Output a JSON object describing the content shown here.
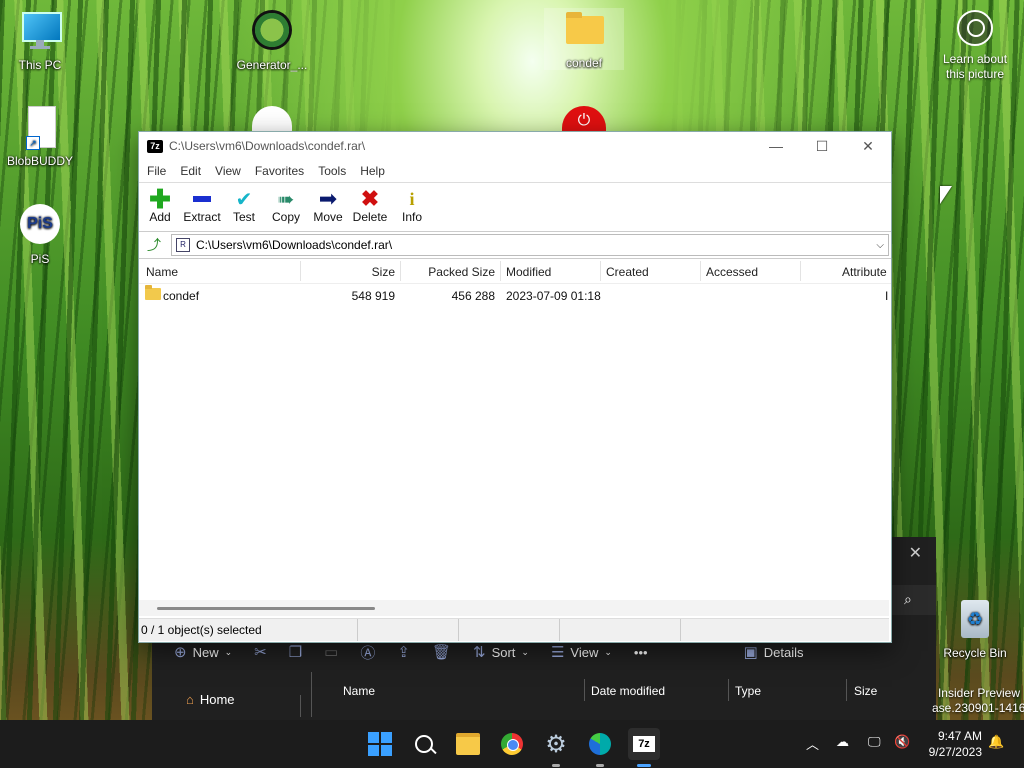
{
  "desktop": {
    "icons": [
      {
        "label": "This PC"
      },
      {
        "label": "Generator_..."
      },
      {
        "label": "condef"
      },
      {
        "label": "BlobBUDDY"
      },
      {
        "label": "PiS"
      },
      {
        "label": "Recycle Bin"
      }
    ],
    "learn_label_1": "Learn about",
    "learn_label_2": "this picture",
    "insider_1": "Insider Preview",
    "insider_2": "ase.230901-1416"
  },
  "explorer_bg": {
    "toolbar": {
      "new": "New",
      "sort": "Sort",
      "view": "View",
      "details": "Details",
      "more": "•••"
    },
    "nav_home": "Home",
    "columns": [
      "Name",
      "Date modified",
      "Type",
      "Size"
    ]
  },
  "zip": {
    "title": "C:\\Users\\vm6\\Downloads\\condef.rar\\",
    "app_icon": "7z",
    "menu": [
      "File",
      "Edit",
      "View",
      "Favorites",
      "Tools",
      "Help"
    ],
    "tools": [
      {
        "label": "Add",
        "icon": "plus-icon",
        "color": "#1fa81f"
      },
      {
        "label": "Extract",
        "icon": "minus-icon",
        "color": "#1a2fd0"
      },
      {
        "label": "Test",
        "icon": "check-icon",
        "color": "#16b5c9"
      },
      {
        "label": "Copy",
        "icon": "double-arrow-icon",
        "color": "#2a8a6a"
      },
      {
        "label": "Move",
        "icon": "arrow-right-icon",
        "color": "#0a1a6e"
      },
      {
        "label": "Delete",
        "icon": "x-icon",
        "color": "#d01010"
      },
      {
        "label": "Info",
        "icon": "info-icon",
        "color": "#d8c010"
      }
    ],
    "address": "C:\\Users\\vm6\\Downloads\\condef.rar\\",
    "columns": [
      "Name",
      "Size",
      "Packed Size",
      "Modified",
      "Created",
      "Accessed",
      "Attribute"
    ],
    "rows": [
      {
        "name": "condef",
        "size": "548 919",
        "packed": "456 288",
        "modified": "2023-07-09 01:18",
        "created": "",
        "accessed": "",
        "attr": "I"
      }
    ],
    "status": "0 / 1 object(s) selected"
  },
  "taskbar": {
    "time": "9:47 AM",
    "date": "9/27/2023"
  },
  "colors": {
    "taskbar": "#1c1c1c",
    "accent": "#0a84ff"
  }
}
